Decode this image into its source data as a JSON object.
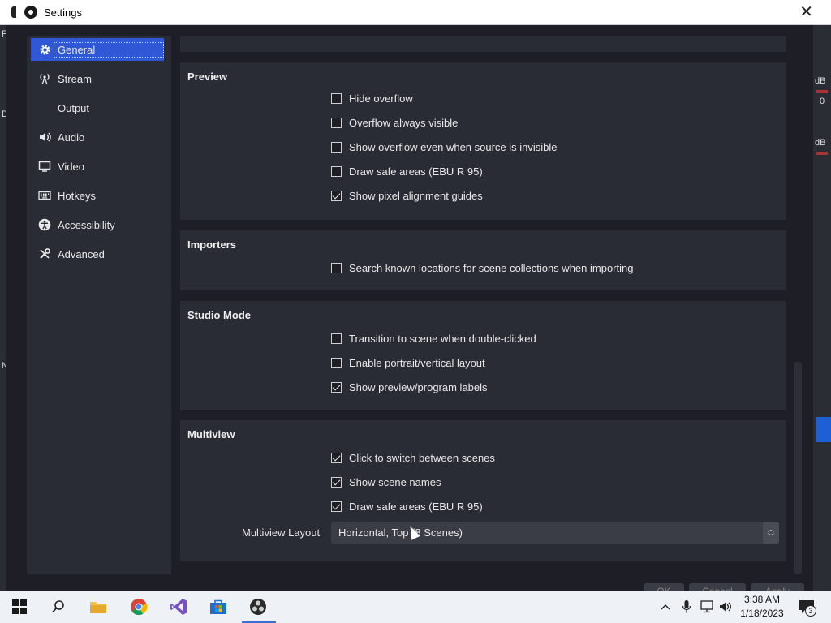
{
  "window": {
    "title": "Settings",
    "close_glyph": "✕"
  },
  "sidebar": {
    "items": [
      {
        "label": "General",
        "icon": "gear-icon"
      },
      {
        "label": "Stream",
        "icon": "broadcast-icon"
      },
      {
        "label": "Output",
        "icon": "output-icon"
      },
      {
        "label": "Audio",
        "icon": "speaker-icon"
      },
      {
        "label": "Video",
        "icon": "monitor-icon"
      },
      {
        "label": "Hotkeys",
        "icon": "keyboard-icon"
      },
      {
        "label": "Accessibility",
        "icon": "accessibility-icon"
      },
      {
        "label": "Advanced",
        "icon": "tools-icon"
      }
    ],
    "active": "General"
  },
  "sections": {
    "preview": {
      "title": "Preview",
      "options": [
        {
          "label": "Hide overflow",
          "checked": false
        },
        {
          "label": "Overflow always visible",
          "checked": false
        },
        {
          "label": "Show overflow even when source is invisible",
          "checked": false
        },
        {
          "label": "Draw safe areas (EBU R 95)",
          "checked": false
        },
        {
          "label": "Show pixel alignment guides",
          "checked": true
        }
      ]
    },
    "importers": {
      "title": "Importers",
      "options": [
        {
          "label": "Search known locations for scene collections when importing",
          "checked": false
        }
      ]
    },
    "studio_mode": {
      "title": "Studio Mode",
      "options": [
        {
          "label": "Transition to scene when double-clicked",
          "checked": false
        },
        {
          "label": "Enable portrait/vertical layout",
          "checked": false
        },
        {
          "label": "Show preview/program labels",
          "checked": true
        }
      ]
    },
    "multiview": {
      "title": "Multiview",
      "options": [
        {
          "label": "Click to switch between scenes",
          "checked": true
        },
        {
          "label": "Show scene names",
          "checked": true
        },
        {
          "label": "Draw safe areas (EBU R 95)",
          "checked": true
        }
      ],
      "layout_label": "Multiview Layout",
      "layout_value": "Horizontal, Top (8 Scenes)"
    }
  },
  "dialog_buttons": [
    "OK",
    "Cancel",
    "Apply"
  ],
  "background_app": {
    "left_letters": [
      "F",
      "D",
      "N"
    ],
    "right_labels": [
      "dB",
      "0",
      "dB"
    ]
  },
  "taskbar": {
    "apps": [
      "windows-start-icon",
      "search-icon",
      "file-explorer-icon",
      "chrome-icon",
      "visual-studio-icon",
      "store-icon",
      "obs-icon"
    ],
    "clock_time": "3:38 AM",
    "clock_date": "1/18/2023",
    "notification_count": "3"
  }
}
